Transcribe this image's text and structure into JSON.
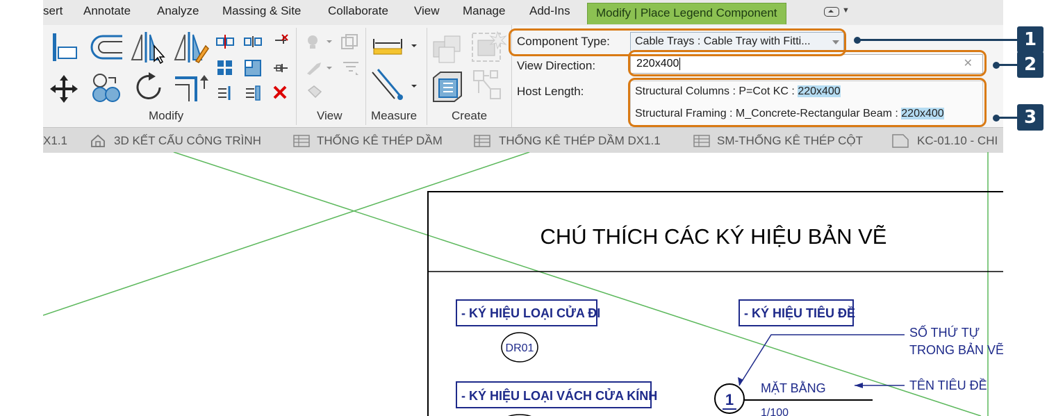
{
  "ribbon": {
    "tabs": [
      {
        "label": "sert",
        "active": false
      },
      {
        "label": "Annotate",
        "active": false
      },
      {
        "label": "Analyze",
        "active": false
      },
      {
        "label": "Massing & Site",
        "active": false
      },
      {
        "label": "Collaborate",
        "active": false
      },
      {
        "label": "View",
        "active": false
      },
      {
        "label": "Manage",
        "active": false
      },
      {
        "label": "Add-Ins",
        "active": false
      },
      {
        "label": "Modify | Place Legend Component",
        "active": true
      }
    ],
    "panels": {
      "modify": "Modify",
      "view": "View",
      "measure": "Measure",
      "create": "Create"
    }
  },
  "options_bar": {
    "component_type_label": "Component Type:",
    "component_type_value": "Cable Trays : Cable Tray with Fitti...",
    "view_direction_label": "View Direction:",
    "view_direction_value": "220x400",
    "host_length_label": "Host Length:",
    "suggestions": [
      {
        "prefix": "Structural Columns : P=Cot KC : ",
        "match": "220x400"
      },
      {
        "prefix": "Structural Framing : M_Concrete-Rectangular Beam : ",
        "match": "220x400"
      }
    ]
  },
  "view_tabs": [
    {
      "label": "X1.1",
      "icon": "none"
    },
    {
      "label": "3D KẾT CẤU CÔNG TRÌNH",
      "icon": "house-icon"
    },
    {
      "label": "THỐNG KÊ THÉP DẦM",
      "icon": "schedule-icon"
    },
    {
      "label": "THỐNG KÊ THÉP DẦM DX1.1",
      "icon": "schedule-icon"
    },
    {
      "label": "SM-THỐNG KÊ THÉP CỘT",
      "icon": "schedule-icon"
    },
    {
      "label": "KC-01.10 - CHI",
      "icon": "sheet-icon"
    }
  ],
  "drawing": {
    "title": "CHÚ THÍCH CÁC KÝ HIỆU BẢN VẼ",
    "door_heading": "- KÝ HIỆU LOẠI CỬA ĐI",
    "door_tag": "DR01",
    "title_heading": "- KÝ HIỆU TIÊU ĐỀ",
    "glass_heading": "- KÝ HIỆU LOẠI VÁCH CỬA KÍNH",
    "order_note_line1": "SỐ THỨ TỰ",
    "order_note_line2": "TRONG BẢN VẼ",
    "title_note": "TÊN TIÊU ĐỀ",
    "section_number": "1",
    "plan_name": "MẶT BẰNG",
    "plan_scale": "1/100"
  },
  "callouts": [
    "1",
    "2",
    "3"
  ],
  "colors": {
    "active_tab": "#8cc152",
    "ring": "#d97a14",
    "marker": "#1d4062",
    "highlight": "#b5dcf2",
    "drawing_blue": "#1e2a8a",
    "crop_green": "#5cb85c"
  }
}
